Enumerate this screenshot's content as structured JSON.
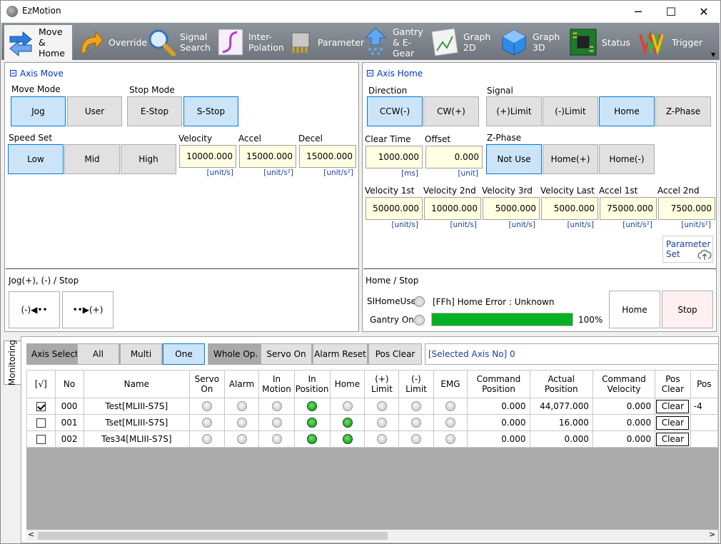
{
  "window": {
    "title": "EzMotion",
    "minimize": "─",
    "maximize": "☐",
    "close": "✕"
  },
  "toolbar": [
    {
      "id": "move-home",
      "line1": "Move",
      "line2": "& Home",
      "icon": "arrows-icon"
    },
    {
      "id": "override",
      "line1": "Override",
      "line2": "",
      "icon": "override-arrow-icon"
    },
    {
      "id": "signal-search",
      "line1": "Signal",
      "line2": "Search",
      "icon": "magnifier-icon"
    },
    {
      "id": "interpolation",
      "line1": "Inter-",
      "line2": "Polation",
      "icon": "curve-icon"
    },
    {
      "id": "parameter",
      "line1": "Parameter",
      "line2": "",
      "icon": "chip-icon"
    },
    {
      "id": "gantry",
      "line1": "Gantry",
      "line2": "& E-Gear",
      "icon": "gantry-icon"
    },
    {
      "id": "graph2d",
      "line1": "Graph",
      "line2": "2D",
      "icon": "graph2d-icon"
    },
    {
      "id": "graph3d",
      "line1": "Graph",
      "line2": "3D",
      "icon": "cube-icon"
    },
    {
      "id": "status",
      "line1": "Status",
      "line2": "",
      "icon": "board-icon"
    },
    {
      "id": "trigger",
      "line1": "Trigger",
      "line2": "",
      "icon": "wave-icon"
    }
  ],
  "axis_move": {
    "title": "Axis Move",
    "move_mode_label": "Move Mode",
    "jog": "Jog",
    "user": "User",
    "stop_mode_label": "Stop Mode",
    "estop": "E-Stop",
    "sstop": "S-Stop",
    "speed_set_label": "Speed Set",
    "low": "Low",
    "mid": "Mid",
    "high": "High",
    "velocity_label": "Velocity",
    "velocity": "10000.000",
    "velocity_unit": "[unit/s]",
    "accel_label": "Accel",
    "accel": "15000.000",
    "accel_unit": "[unit/s²]",
    "decel_label": "Decel",
    "decel": "15000.000",
    "decel_unit": "[unit/s²]",
    "jog_section": "Jog(+), (-) / Stop",
    "jog_minus": "(-)◀••",
    "jog_plus": "••▶(+)"
  },
  "axis_home": {
    "title": "Axis Home",
    "direction_label": "Direction",
    "ccw": "CCW(-)",
    "cw": "CW(+)",
    "signal_label": "Signal",
    "plus_limit": "(+)Limit",
    "minus_limit": "(-)Limit",
    "home": "Home",
    "zphase": "Z-Phase",
    "clear_time_label": "Clear Time",
    "clear_time": "1000.000",
    "clear_time_unit": "[ms]",
    "offset_label": "Offset",
    "offset": "0.000",
    "offset_unit": "[unit]",
    "zphase_label": "Z-Phase",
    "not_use": "Not Use",
    "home_plus": "Home(+)",
    "home_minus": "Home(-)",
    "vel1_label": "Velocity 1st",
    "vel1": "50000.000",
    "vel1_unit": "[unit/s]",
    "vel2_label": "Velocity 2nd",
    "vel2": "10000.000",
    "vel2_unit": "[unit/s]",
    "vel3_label": "Velocity 3rd",
    "vel3": "5000.000",
    "vel3_unit": "[unit/s]",
    "vellast_label": "Velocity Last",
    "vellast": "5000.000",
    "vellast_unit": "[unit/s]",
    "acc1_label": "Accel 1st",
    "acc1": "75000.000",
    "acc1_unit": "[unit/s²]",
    "acc2_label": "Accel 2nd",
    "acc2": "7500.000",
    "acc2_unit": "[unit/s²]",
    "param_set_line1": "Parameter",
    "param_set_line2": "Set",
    "home_stop_section": "Home / Stop",
    "sihomeuse_label": "SIHomeUse",
    "status_text": "[FFh] Home Error : Unknown",
    "gantry_on_label": "Gantry On",
    "progress": 1.0,
    "progress_text": "100%",
    "home_btn": "Home",
    "stop_btn": "Stop"
  },
  "monitoring": {
    "tab": "Monitoring",
    "axis_select": "Axis Select",
    "all": "All",
    "multi": "Multi",
    "one": "One",
    "whole_op": "Whole Op.",
    "servo_on": "Servo On",
    "alarm_reset": "Alarm Reset",
    "pos_clear": "Pos Clear",
    "selected_axis": "[Selected Axis No] 0"
  },
  "table": {
    "headers": [
      {
        "l1": "[√]",
        "l2": ""
      },
      {
        "l1": "No",
        "l2": ""
      },
      {
        "l1": "Name",
        "l2": ""
      },
      {
        "l1": "Servo",
        "l2": "On"
      },
      {
        "l1": "Alarm",
        "l2": ""
      },
      {
        "l1": "In",
        "l2": "Motion"
      },
      {
        "l1": "In",
        "l2": "Position"
      },
      {
        "l1": "Home",
        "l2": ""
      },
      {
        "l1": "(+)",
        "l2": "Limit"
      },
      {
        "l1": "(-)",
        "l2": "Limit"
      },
      {
        "l1": "EMG",
        "l2": ""
      },
      {
        "l1": "Command",
        "l2": "Position"
      },
      {
        "l1": "Actual",
        "l2": "Position"
      },
      {
        "l1": "Command",
        "l2": "Velocity"
      },
      {
        "l1": "Pos",
        "l2": "Clear"
      },
      {
        "l1": "Pos",
        "l2": ""
      }
    ],
    "rows": [
      {
        "checked": true,
        "no": "000",
        "name": "Test[MLIII-S7S]",
        "servo": false,
        "alarm": false,
        "motion": false,
        "inpos": true,
        "home": false,
        "plimit": false,
        "mlimit": false,
        "emg": false,
        "cmdpos": "0.000",
        "actpos": "44,077.000",
        "cmdvel": "0.000",
        "clear": "Clear",
        "extra": "-4"
      },
      {
        "checked": false,
        "no": "001",
        "name": "Tset[MLIII-S7S]",
        "servo": false,
        "alarm": false,
        "motion": false,
        "inpos": true,
        "home": true,
        "plimit": false,
        "mlimit": false,
        "emg": false,
        "cmdpos": "0.000",
        "actpos": "16.000",
        "cmdvel": "0.000",
        "clear": "Clear",
        "extra": ""
      },
      {
        "checked": false,
        "no": "002",
        "name": "Tes34[MLIII-S7S]",
        "servo": false,
        "alarm": false,
        "motion": false,
        "inpos": true,
        "home": true,
        "plimit": false,
        "mlimit": false,
        "emg": false,
        "cmdpos": "0.000",
        "actpos": "0.000",
        "cmdvel": "0.000",
        "clear": "Clear",
        "extra": ""
      }
    ]
  },
  "scroll": {
    "left": "<",
    "right": ">",
    "up": "▲",
    "down": "▼"
  }
}
